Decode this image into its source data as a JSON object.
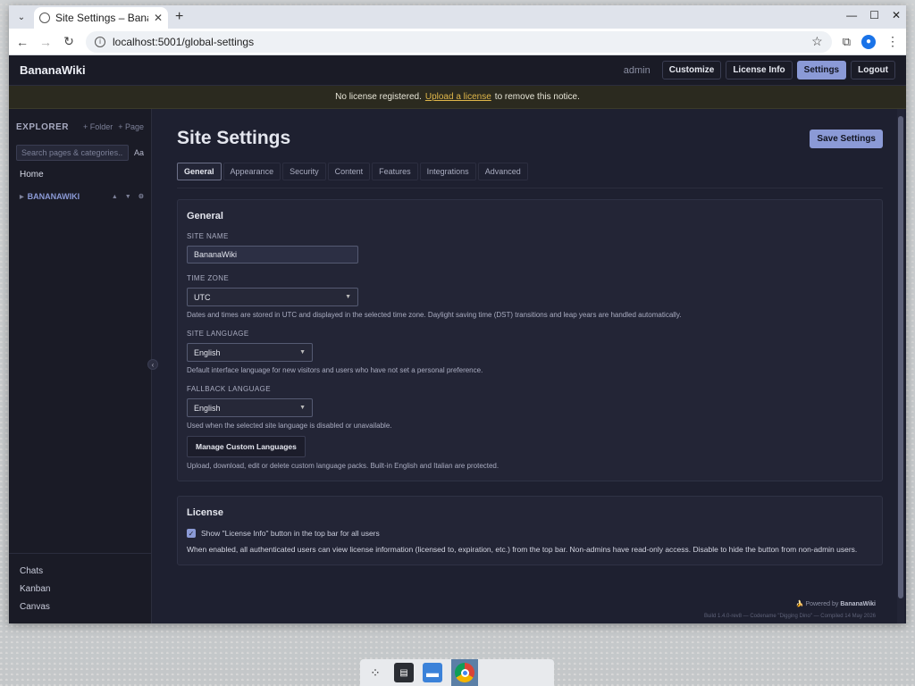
{
  "browser": {
    "tab_title": "Site Settings – BananaWiki",
    "url": "localhost:5001/global-settings",
    "new_tab": "+",
    "tab_close": "✕"
  },
  "header": {
    "brand": "BananaWiki",
    "user": "admin",
    "buttons": [
      "Customize",
      "License Info",
      "Settings",
      "Logout"
    ],
    "active_button": "Settings"
  },
  "banner": {
    "before": "No license registered.",
    "link": "Upload a license",
    "after": "to remove this notice."
  },
  "sidebar": {
    "title": "EXPLORER",
    "add_folder": "+ Folder",
    "add_page": "+ Page",
    "search_placeholder": "Search pages & categories...",
    "font_toggle": "Aa",
    "home": "Home",
    "root": "BANANAWIKI",
    "bottom_items": [
      "Chats",
      "Kanban",
      "Canvas"
    ]
  },
  "main": {
    "title": "Site Settings",
    "save_label": "Save Settings",
    "tabs": [
      "General",
      "Appearance",
      "Security",
      "Content",
      "Features",
      "Integrations",
      "Advanced"
    ],
    "active_tab": "General",
    "general": {
      "heading": "General",
      "site_name_label": "SITE NAME",
      "site_name_value": "BananaWiki",
      "timezone_label": "TIME ZONE",
      "timezone_value": "UTC",
      "timezone_help": "Dates and times are stored in UTC and displayed in the selected time zone. Daylight saving time (DST) transitions and leap years are handled automatically.",
      "site_language_label": "SITE LANGUAGE",
      "site_language_value": "English",
      "site_language_help": "Default interface language for new visitors and users who have not set a personal preference.",
      "fallback_language_label": "FALLBACK LANGUAGE",
      "fallback_language_value": "English",
      "fallback_language_help": "Used when the selected site language is disabled or unavailable.",
      "manage_button": "Manage Custom Languages",
      "manage_help": "Upload, download, edit or delete custom language packs. Built-in English and Italian are protected."
    },
    "license": {
      "heading": "License",
      "checkbox_label": "Show \"License Info\" button in the top bar for all users",
      "checkbox_checked": true,
      "description": "When enabled, all authenticated users can view license information (licensed to, expiration, etc.) from the top bar. Non-admins have read-only access. Disable to hide the button from non-admin users."
    },
    "footer": {
      "powered_prefix": "🍌 Powered by",
      "powered_brand": "BananaWiki",
      "build": "Build 1.4.0-rev8 — Codename \"Digging Dino\" — Compiled 14 May 2026"
    }
  }
}
